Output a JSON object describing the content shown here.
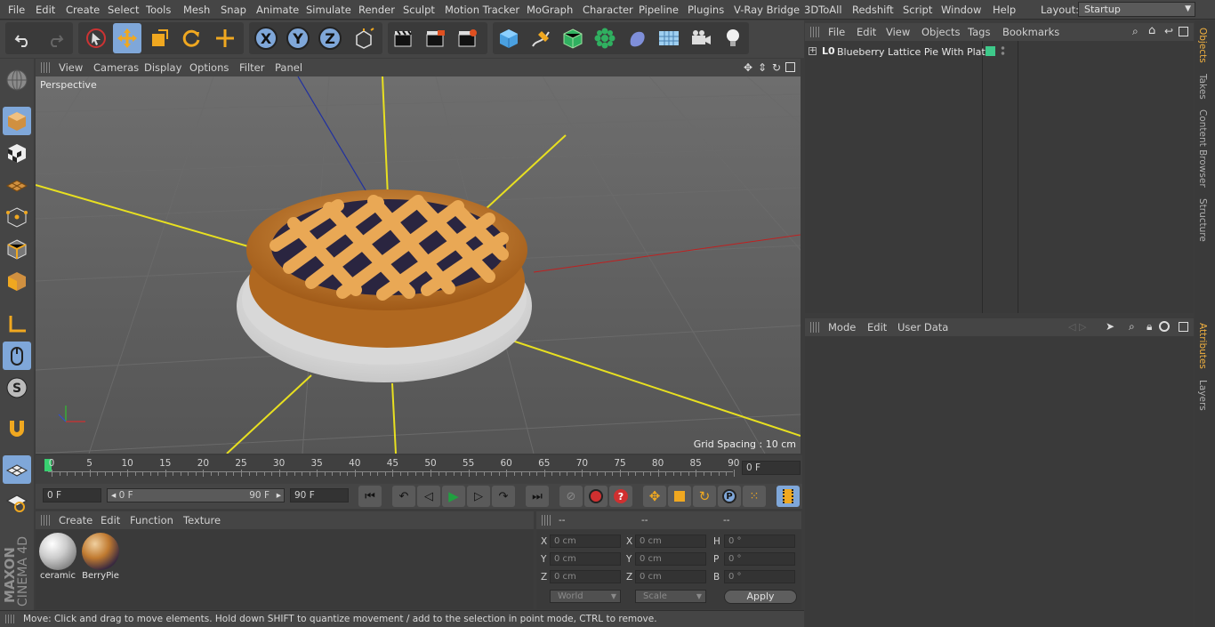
{
  "menubar": {
    "items": [
      "File",
      "Edit",
      "Create",
      "Select",
      "Tools",
      "Mesh",
      "Snap",
      "Animate",
      "Simulate",
      "Render",
      "Sculpt",
      "Motion Tracker",
      "MoGraph",
      "Character",
      "Pipeline",
      "Plugins",
      "V-Ray Bridge",
      "3DToAll",
      "Redshift",
      "Script",
      "Window",
      "Help"
    ],
    "layout_label": "Layout:",
    "layout_value": "Startup"
  },
  "toolbar": {
    "axis_x": "X",
    "axis_y": "Y",
    "axis_z": "Z"
  },
  "viewport": {
    "menu": [
      "View",
      "Cameras",
      "Display",
      "Options",
      "Filter",
      "Panel"
    ],
    "camera_label": "Perspective",
    "grid_spacing": "Grid Spacing : 10 cm"
  },
  "timeline": {
    "ticks": [
      "0",
      "5",
      "10",
      "15",
      "20",
      "25",
      "30",
      "35",
      "40",
      "45",
      "50",
      "55",
      "60",
      "65",
      "70",
      "75",
      "80",
      "85",
      "90"
    ],
    "current_frame": "0 F"
  },
  "transport": {
    "start_field": "0 F",
    "range_start": "0 F",
    "range_end": "90 F",
    "end_field": "90 F"
  },
  "materials": {
    "menu": [
      "Create",
      "Edit",
      "Function",
      "Texture"
    ],
    "items": [
      {
        "name": "ceramic"
      },
      {
        "name": "BerryPie"
      }
    ]
  },
  "coordinates": {
    "headers": [
      "--",
      "--",
      "--"
    ],
    "pos_labels": [
      "X",
      "Y",
      "Z"
    ],
    "size_labels": [
      "X",
      "Y",
      "Z"
    ],
    "rot_labels": [
      "H",
      "P",
      "B"
    ],
    "pos_values": [
      "0 cm",
      "0 cm",
      "0 cm"
    ],
    "size_values": [
      "0 cm",
      "0 cm",
      "0 cm"
    ],
    "rot_values": [
      "0 °",
      "0 °",
      "0 °"
    ],
    "mode_select": "World",
    "scale_select": "Scale",
    "apply_label": "Apply"
  },
  "status": {
    "text": "Move: Click and drag to move elements. Hold down SHIFT to quantize movement / add to the selection in point mode, CTRL to remove."
  },
  "objects": {
    "menu": [
      "File",
      "Edit",
      "View",
      "Objects",
      "Tags",
      "Bookmarks"
    ],
    "items": [
      {
        "name": "Blueberry Lattice Pie With Plate"
      }
    ]
  },
  "attributes": {
    "menu": [
      "Mode",
      "Edit",
      "User Data"
    ]
  },
  "side_tabs": [
    "Objects",
    "Takes",
    "Content Browser",
    "Structure",
    "Attributes",
    "Layers"
  ],
  "brand": {
    "maker": "MAXON",
    "product": "CINEMA 4D"
  },
  "colors": {
    "accent": "#7fa7d9",
    "active_tab": "#f0b040",
    "axis_yellow": "#e8e020",
    "layer_green": "#3ec98a"
  }
}
